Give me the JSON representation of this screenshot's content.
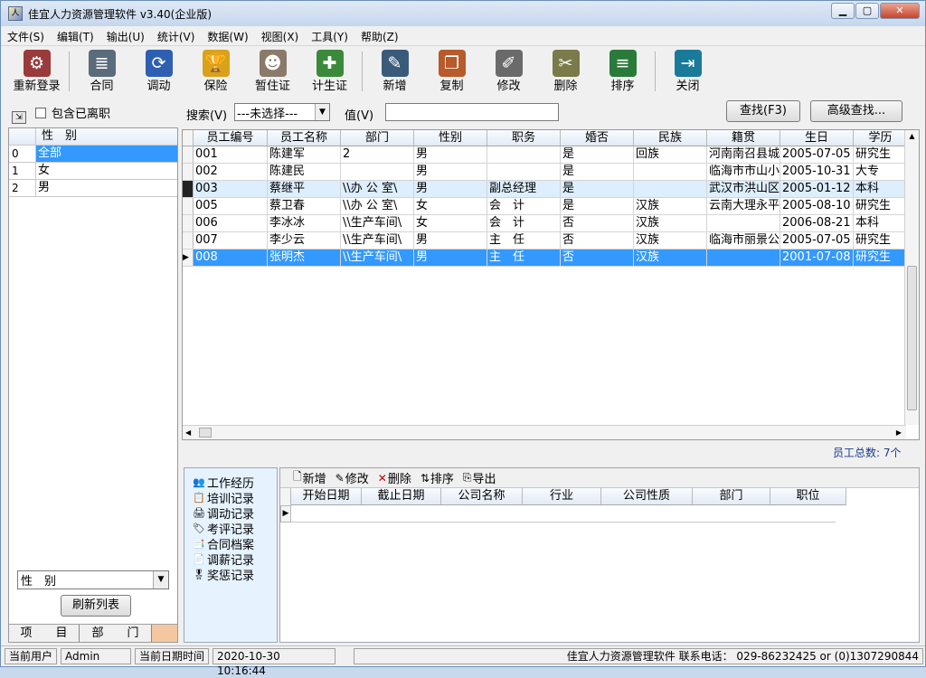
{
  "window": {
    "title": "佳宜人力资源管理软件 v3.40(企业版)",
    "icon_name": "app-icon"
  },
  "menu": [
    "文件(S)",
    "编辑(T)",
    "输出(U)",
    "统计(V)",
    "数据(W)",
    "视图(X)",
    "工具(Y)",
    "帮助(Z)"
  ],
  "toolbar": [
    {
      "label": "重新登录",
      "icon": "relogin-icon",
      "color": "#9a3a3a",
      "glyph": "⚙"
    },
    {
      "label": "合同",
      "icon": "contract-icon",
      "color": "#5a6b7c",
      "glyph": "≣"
    },
    {
      "label": "调动",
      "icon": "transfer-icon",
      "color": "#2f5fb0",
      "glyph": "⟳"
    },
    {
      "label": "保险",
      "icon": "insurance-icon",
      "color": "#d9a21a",
      "glyph": "🏆"
    },
    {
      "label": "暂住证",
      "icon": "residence-permit-icon",
      "color": "#8a7a6a",
      "glyph": "☻"
    },
    {
      "label": "计生证",
      "icon": "family-planning-icon",
      "color": "#3a8a3a",
      "glyph": "✚"
    },
    {
      "label": "新增",
      "icon": "new-icon",
      "color": "#3a5a7a",
      "glyph": "✎"
    },
    {
      "label": "复制",
      "icon": "copy-icon",
      "color": "#b85a2a",
      "glyph": "❐"
    },
    {
      "label": "修改",
      "icon": "edit-icon",
      "color": "#6a6a6a",
      "glyph": "✐"
    },
    {
      "label": "删除",
      "icon": "delete-icon",
      "color": "#7a7a4a",
      "glyph": "✂"
    },
    {
      "label": "排序",
      "icon": "sort-icon",
      "color": "#2a7a3a",
      "glyph": "≡"
    },
    {
      "label": "关闭",
      "icon": "close-app-icon",
      "color": "#1a7a9a",
      "glyph": "⇥"
    }
  ],
  "search": {
    "include_left_label": "包含已离职",
    "search_label": "搜索(V)",
    "search_select_value": "---未选择---",
    "value_label": "值(V)",
    "value_input": "",
    "find_button": "查找(F3)",
    "advanced_button": "高级查找..."
  },
  "sidebar": {
    "header": "性　别",
    "rows": [
      {
        "idx": "0",
        "value": "全部",
        "selected": true
      },
      {
        "idx": "1",
        "value": "女",
        "selected": false
      },
      {
        "idx": "2",
        "value": "男",
        "selected": false
      }
    ],
    "group_select": "性　别",
    "refresh_button": "刷新列表",
    "tab_items": "项　　目",
    "tab_departments": "部　　门"
  },
  "employees": {
    "columns": [
      "员工编号",
      "员工名称",
      "部门",
      "性别",
      "职务",
      "婚否",
      "民族",
      "籍贯",
      "生日",
      "学历"
    ],
    "rows": [
      [
        "001",
        "陈建军",
        "2",
        "男",
        "",
        "是",
        "回族",
        "河南南召县城",
        "2005-07-05",
        "研究生"
      ],
      [
        "002",
        "陈建民",
        "",
        "男",
        "",
        "是",
        "",
        "临海市市山小",
        "2005-10-31",
        "大专"
      ],
      [
        "003",
        "蔡继平",
        "\\\\办 公 室\\",
        "男",
        "副总经理",
        "是",
        "",
        "武汉市洪山区",
        "2005-01-12",
        "本科"
      ],
      [
        "005",
        "蔡卫春",
        "\\\\办 公 室\\",
        "女",
        "会　计",
        "是",
        "汉族",
        "云南大理永平",
        "2005-08-10",
        "研究生"
      ],
      [
        "006",
        "李冰冰",
        "\\\\生产车间\\",
        "女",
        "会　计",
        "否",
        "汉族",
        "",
        "2006-08-21",
        "本科"
      ],
      [
        "007",
        "李少云",
        "\\\\生产车间\\",
        "男",
        "主　任",
        "否",
        "汉族",
        "临海市丽景公",
        "2005-07-05",
        "研究生"
      ],
      [
        "008",
        "张明杰",
        "\\\\生产车间\\",
        "男",
        "主　任",
        "否",
        "汉族",
        "",
        "2001-07-08",
        "研究生"
      ]
    ],
    "selected_row": 6,
    "highlight_row": 2,
    "total": "员工总数: 7个"
  },
  "record_nav": [
    "工作经历",
    "培训记录",
    "调动记录",
    "考评记录",
    "合同档案",
    "调薪记录",
    "奖惩记录"
  ],
  "detail": {
    "toolbar": [
      "新增",
      "修改",
      "删除",
      "排序",
      "导出"
    ],
    "columns": [
      "开始日期",
      "截止日期",
      "公司名称",
      "行业",
      "公司性质",
      "部门",
      "职位"
    ]
  },
  "status": {
    "user_label": "当前用户",
    "user": "Admin",
    "datetime_label": "当前日期时间",
    "datetime": "2020-10-30 10:16:44",
    "contact": "佳宜人力资源管理软件 联系电话： 029-86232425 or (0)1307290844"
  }
}
